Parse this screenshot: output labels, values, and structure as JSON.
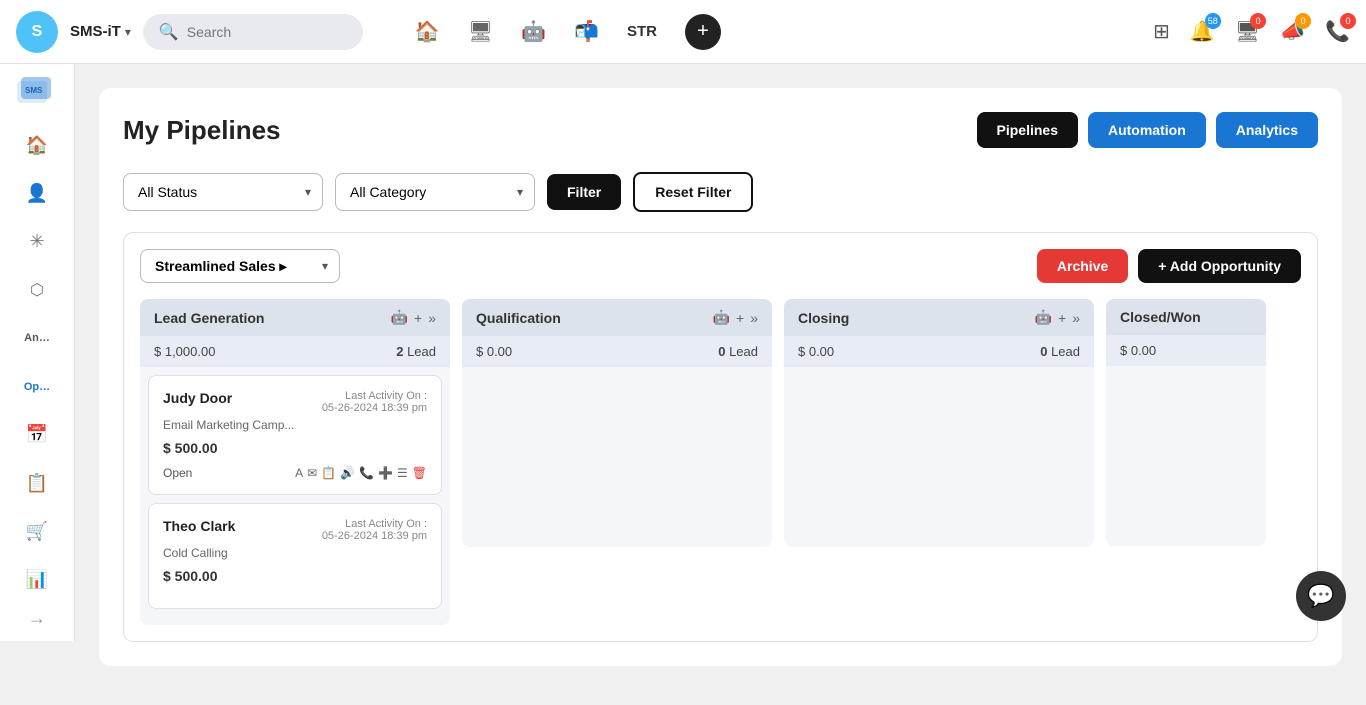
{
  "brand": {
    "initials": "S",
    "name": "SMS-iT",
    "dropdown_arrow": "▾"
  },
  "search": {
    "placeholder": "Search"
  },
  "nav_center": {
    "home_icon": "🏠",
    "monitor_icon": "🖥",
    "robot_icon": "🤖",
    "mail_icon": "📬",
    "str_label": "STR",
    "plus_label": "+"
  },
  "nav_right": {
    "grid_icon": "⊞",
    "bell_badge": "58",
    "monitor_badge": "0",
    "megaphone_badge": "0",
    "phone_badge": "0"
  },
  "sidebar": {
    "logo_text": "SMS-iT",
    "items": [
      {
        "id": "home",
        "icon": "🏠",
        "label": ""
      },
      {
        "id": "person",
        "icon": "👤",
        "label": ""
      },
      {
        "id": "network",
        "icon": "✳",
        "label": ""
      },
      {
        "id": "funnel",
        "icon": "⬣",
        "label": ""
      },
      {
        "id": "analytics",
        "icon": "An…",
        "label": "An…"
      },
      {
        "id": "opportunities",
        "icon": "Op…",
        "label": "Op…"
      },
      {
        "id": "calendar",
        "icon": "📅",
        "label": ""
      },
      {
        "id": "notes",
        "icon": "📋",
        "label": ""
      },
      {
        "id": "cart",
        "icon": "🛒",
        "label": ""
      },
      {
        "id": "report",
        "icon": "📊",
        "label": ""
      }
    ],
    "arrow": "→"
  },
  "page": {
    "title": "My Pipelines",
    "header_buttons": {
      "pipelines": "Pipelines",
      "automation": "Automation",
      "analytics": "Analytics"
    }
  },
  "filters": {
    "status_default": "All Status",
    "category_default": "All Category",
    "filter_btn": "Filter",
    "reset_btn": "Reset Filter"
  },
  "pipeline": {
    "selected": "Streamlined Sales ▸",
    "archive_btn": "Archive",
    "add_opp_btn": "+ Add Opportunity"
  },
  "kanban": {
    "columns": [
      {
        "id": "lead-gen",
        "title": "Lead Generation",
        "amount": "$ 1,000.00",
        "lead_count": "2",
        "lead_label": "Lead",
        "cards": [
          {
            "name": "Judy Door",
            "sub": "Email Marketing Camp...",
            "last_activity_label": "Last Activity On :",
            "last_activity_date": "05-26-2024 18:39 pm",
            "amount": "$ 500.00",
            "status": "Open",
            "icons": [
              "A",
              "✉",
              "📋",
              "🔊",
              "📞",
              "➕",
              "☰",
              "🗑"
            ]
          },
          {
            "name": "Theo Clark",
            "sub": "Cold Calling",
            "last_activity_label": "Last Activity On :",
            "last_activity_date": "05-26-2024 18:39 pm",
            "amount": "$ 500.00",
            "status": "",
            "icons": []
          }
        ]
      },
      {
        "id": "qualification",
        "title": "Qualification",
        "amount": "$ 0.00",
        "lead_count": "0",
        "lead_label": "Lead",
        "cards": []
      },
      {
        "id": "closing",
        "title": "Closing",
        "amount": "$ 0.00",
        "lead_count": "0",
        "lead_label": "Lead",
        "cards": []
      },
      {
        "id": "closed-won",
        "title": "Closed/Won",
        "amount": "$ 0.00",
        "lead_count": null,
        "lead_label": null,
        "cards": []
      }
    ]
  },
  "chat_fab": "💬"
}
